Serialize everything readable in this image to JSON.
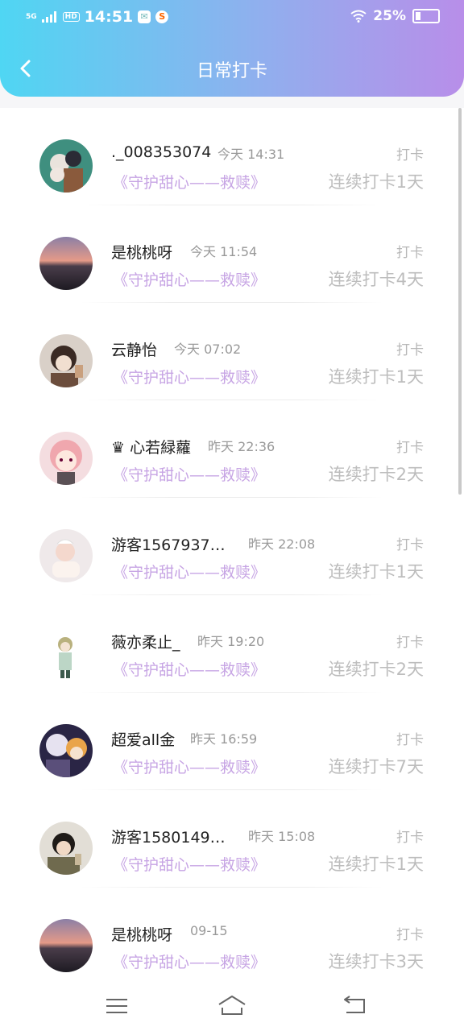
{
  "status_bar": {
    "network": "5G",
    "hd": "HD",
    "time": "14:51",
    "battery": "25%"
  },
  "header": {
    "title": "日常打卡"
  },
  "list": [
    {
      "name": "._008353074",
      "time": "今天 14:31",
      "program": "《守护甜心——救赎》",
      "action": "打卡",
      "streak": "连续打卡1天"
    },
    {
      "name": "是桃桃呀",
      "time": "今天 11:54",
      "program": "《守护甜心——救赎》",
      "action": "打卡",
      "streak": "连续打卡4天"
    },
    {
      "name": "云静怡",
      "time": "今天 07:02",
      "program": "《守护甜心——救赎》",
      "action": "打卡",
      "streak": "连续打卡1天"
    },
    {
      "name": "♛ 心若緑蘿",
      "time": "昨天 22:36",
      "program": "《守护甜心——救赎》",
      "action": "打卡",
      "streak": "连续打卡2天"
    },
    {
      "name": "游客15679379...",
      "time": "昨天 22:08",
      "program": "《守护甜心——救赎》",
      "action": "打卡",
      "streak": "连续打卡1天"
    },
    {
      "name": "薇亦柔止_",
      "time": "昨天 19:20",
      "program": "《守护甜心——救赎》",
      "action": "打卡",
      "streak": "连续打卡2天"
    },
    {
      "name": "超爱all金",
      "time": "昨天 16:59",
      "program": "《守护甜心——救赎》",
      "action": "打卡",
      "streak": "连续打卡7天"
    },
    {
      "name": "游客15801491...",
      "time": "昨天 15:08",
      "program": "《守护甜心——救赎》",
      "action": "打卡",
      "streak": "连续打卡1天"
    },
    {
      "name": "是桃桃呀",
      "time": "09-15",
      "program": "《守护甜心——救赎》",
      "action": "打卡",
      "streak": "连续打卡3天"
    }
  ]
}
